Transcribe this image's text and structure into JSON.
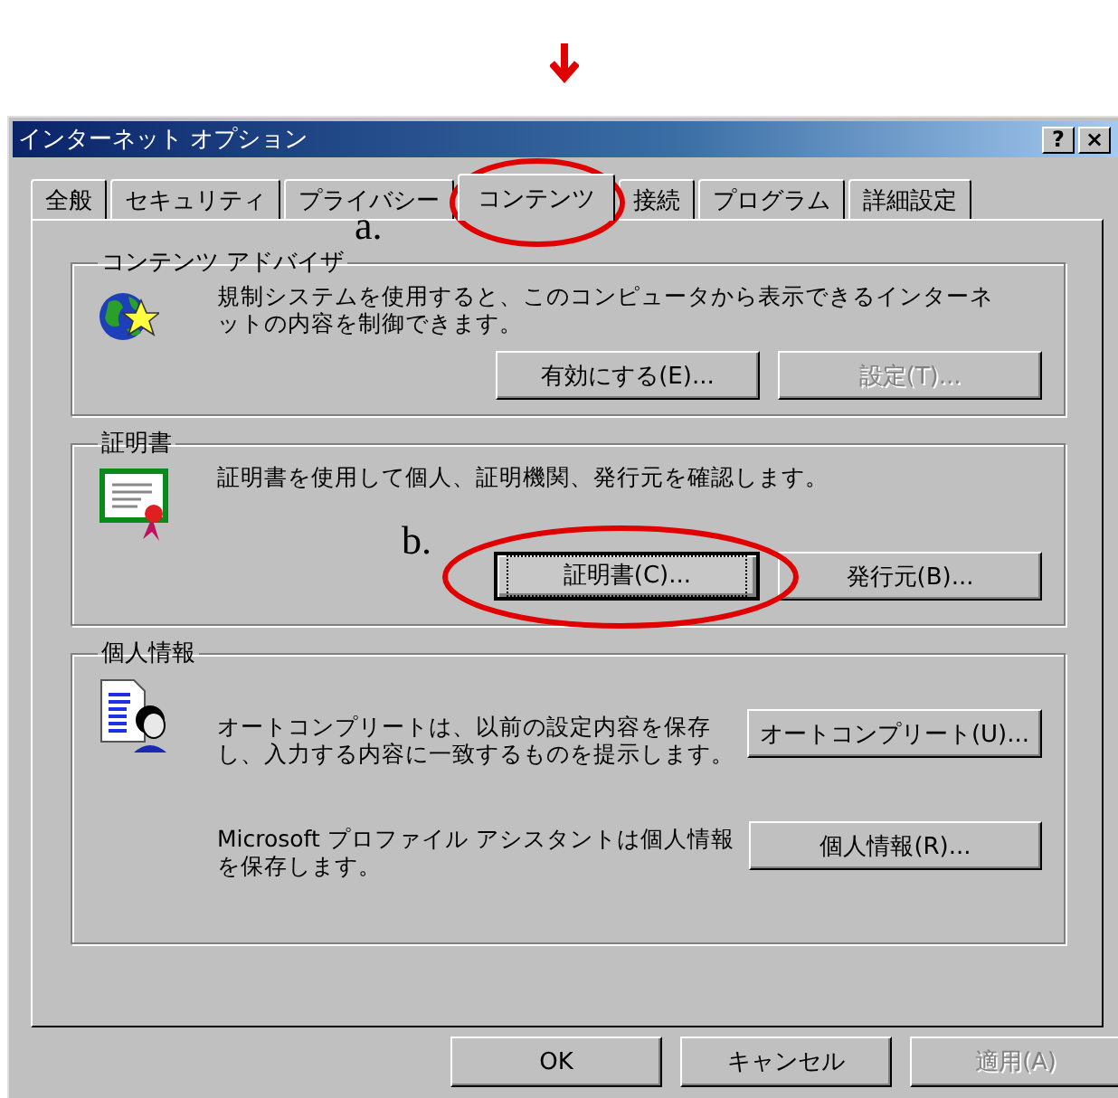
{
  "window": {
    "title": "インターネット オプション",
    "help_button": "?",
    "close_button": "×"
  },
  "tabs": [
    {
      "label": "全般",
      "selected": false
    },
    {
      "label": "セキュリティ",
      "selected": false
    },
    {
      "label": "プライバシー",
      "selected": false
    },
    {
      "label": "コンテンツ",
      "selected": true
    },
    {
      "label": "接続",
      "selected": false
    },
    {
      "label": "プログラム",
      "selected": false
    },
    {
      "label": "詳細設定",
      "selected": false
    }
  ],
  "groups": [
    {
      "title": "コンテンツ アドバイザ",
      "kind": "stacked",
      "rows": [
        {
          "text": "規制システムを使用すると、このコンピュータから表示できるインターネットの内容を制御できます。",
          "buttons": [
            {
              "label": "有効にする(E)...",
              "disabled": false,
              "focused": false
            },
            {
              "label": "設定(T)...",
              "disabled": true,
              "focused": false
            }
          ]
        }
      ]
    },
    {
      "title": "証明書",
      "kind": "stacked",
      "rows": [
        {
          "text": "証明書を使用して個人、証明機関、発行元を確認します。",
          "buttons": [
            {
              "label": "証明書(C)...",
              "disabled": false,
              "focused": true
            },
            {
              "label": "発行元(B)...",
              "disabled": false,
              "focused": false
            }
          ]
        }
      ]
    },
    {
      "title": "個人情報",
      "kind": "side",
      "rows": [
        {
          "text": "オートコンプリートは、以前の設定内容を保存し、入力する内容に一致するものを提示します。",
          "buttons": [
            {
              "label": "オートコンプリート(U)...",
              "disabled": false,
              "focused": false
            }
          ]
        },
        {
          "text": "Microsoft プロファイル アシスタントは個人情報を保存します。",
          "buttons": [
            {
              "label": "個人情報(R)...",
              "disabled": false,
              "focused": false
            }
          ]
        }
      ]
    }
  ],
  "footer_buttons": [
    {
      "label": "OK",
      "disabled": false
    },
    {
      "label": "キャンセル",
      "disabled": false
    },
    {
      "label": "適用(A)",
      "disabled": true
    }
  ],
  "annotations": [
    {
      "label": "a."
    },
    {
      "label": "b."
    }
  ]
}
